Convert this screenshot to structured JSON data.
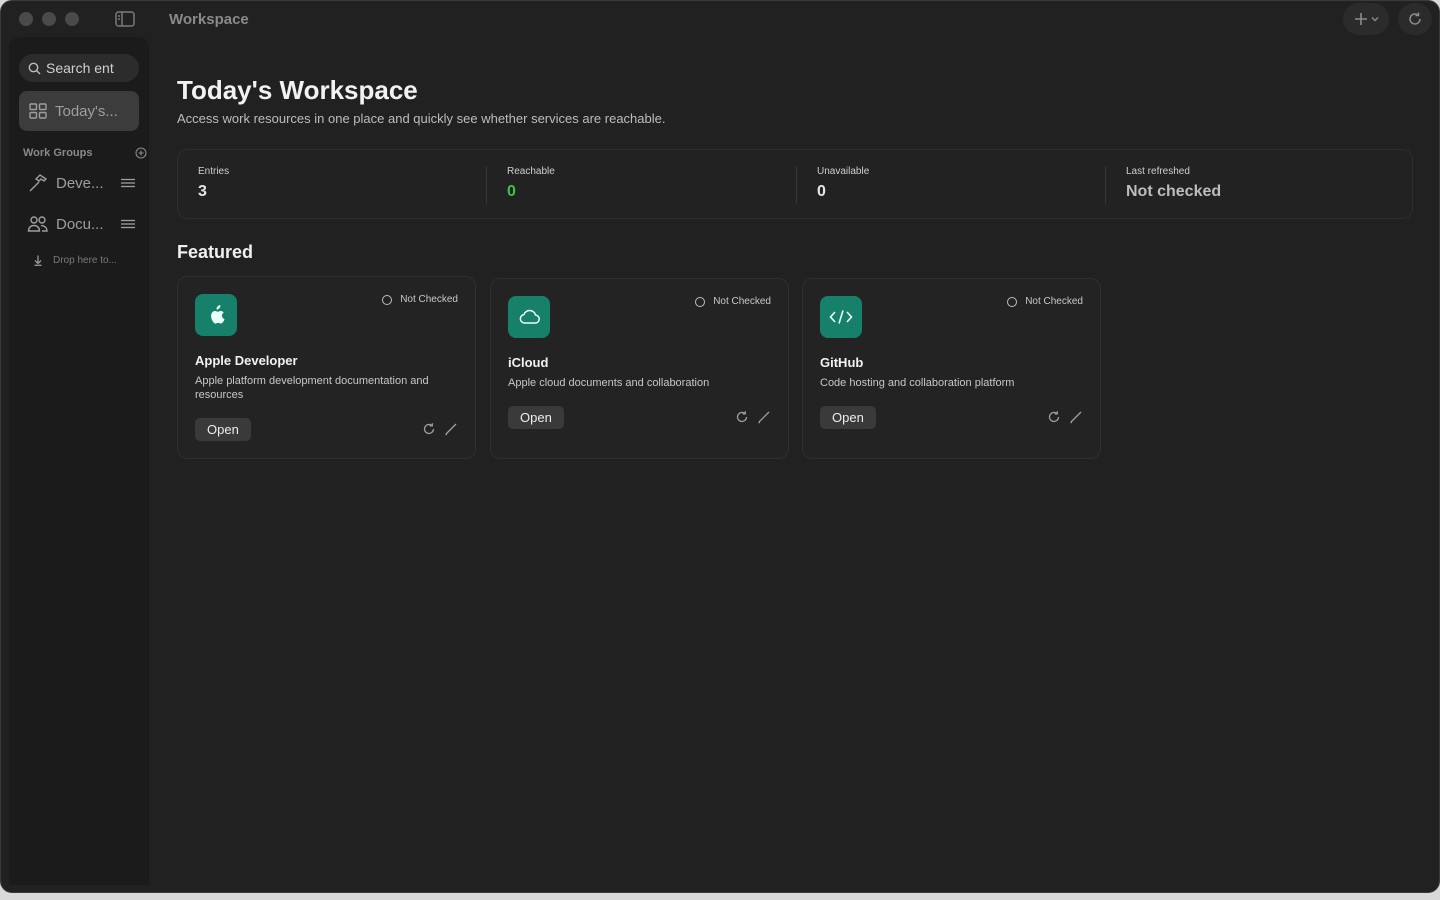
{
  "window": {
    "title": "Workspace",
    "add_icon": "plus-icon",
    "refresh_icon": "refresh-icon"
  },
  "sidebar": {
    "search": {
      "placeholder": "Search ent",
      "value": ""
    },
    "today_label": "Today's...",
    "work_groups_label": "Work Groups",
    "groups": [
      {
        "label": "Deve...",
        "icon": "hammer-icon"
      },
      {
        "label": "Docu...",
        "icon": "people-icon"
      }
    ],
    "drop_hint": "Drop here to..."
  },
  "main": {
    "title": "Today's Workspace",
    "subtitle": "Access work resources in one place and quickly see whether services are reachable.",
    "stats": {
      "entries": {
        "label": "Entries",
        "value": "3"
      },
      "reachable": {
        "label": "Reachable",
        "value": "0"
      },
      "unavailable": {
        "label": "Unavailable",
        "value": "0"
      },
      "last_refreshed": {
        "label": "Last refreshed",
        "value": "Not checked"
      }
    },
    "featured_title": "Featured",
    "cards": [
      {
        "name": "Apple Developer",
        "description": "Apple platform development documentation and resources",
        "status": "Not Checked",
        "open_label": "Open",
        "icon": "apple-icon"
      },
      {
        "name": "iCloud",
        "description": "Apple cloud documents and collaboration",
        "status": "Not Checked",
        "open_label": "Open",
        "icon": "cloud-icon"
      },
      {
        "name": "GitHub",
        "description": "Code hosting and collaboration platform",
        "status": "Not Checked",
        "open_label": "Open",
        "icon": "code-icon"
      }
    ]
  },
  "colors": {
    "accent": "#16806a",
    "reachable": "#3ac24a",
    "background": "#212121"
  }
}
